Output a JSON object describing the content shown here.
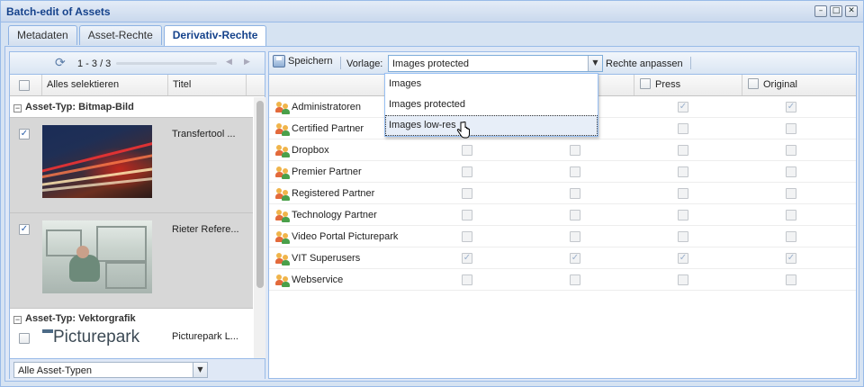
{
  "window": {
    "title": "Batch-edit of Assets",
    "controls": [
      "–",
      "□",
      "✕"
    ]
  },
  "tabs": [
    {
      "label": "Metadaten",
      "active": false
    },
    {
      "label": "Asset-Rechte",
      "active": false
    },
    {
      "label": "Derivativ-Rechte",
      "active": true
    }
  ],
  "left": {
    "pager": "1 - 3 / 3",
    "header": {
      "select_all": "Alles selektieren",
      "title_col": "Titel"
    },
    "groups": [
      {
        "label": "Asset-Typ: Bitmap-Bild"
      },
      {
        "label": "Asset-Typ: Vektorgrafik"
      }
    ],
    "assets": [
      {
        "title": "Transfertool ...",
        "checked": true
      },
      {
        "title": "Rieter Refere...",
        "checked": true
      },
      {
        "title": "Picturepark L...",
        "checked": false,
        "logo_text": "Picturepark"
      }
    ],
    "filter": {
      "value": "Alle Asset-Typen"
    }
  },
  "right": {
    "toolbar": {
      "save_label": "Speichern",
      "vorlage_label": "Vorlage:",
      "vorlage_value": "Images protected",
      "anpassen_label": "Rechte anpassen"
    },
    "columns": [
      "Press",
      "Original"
    ],
    "dropdown_options": [
      "Images",
      "Images protected",
      "Images low-res"
    ],
    "hovered_option": "Images low-res",
    "rows": [
      {
        "name": "Administratoren",
        "c1": false,
        "c2": false,
        "c3": true,
        "c4": true
      },
      {
        "name": "Certified Partner",
        "c1": false,
        "c2": false,
        "c3": false,
        "c4": false
      },
      {
        "name": "Dropbox",
        "c1": false,
        "c2": false,
        "c3": false,
        "c4": false
      },
      {
        "name": "Premier Partner",
        "c1": false,
        "c2": false,
        "c3": false,
        "c4": false
      },
      {
        "name": "Registered Partner",
        "c1": false,
        "c2": false,
        "c3": false,
        "c4": false
      },
      {
        "name": "Technology Partner",
        "c1": false,
        "c2": false,
        "c3": false,
        "c4": false
      },
      {
        "name": "Video Portal Picturepark",
        "c1": false,
        "c2": false,
        "c3": false,
        "c4": false
      },
      {
        "name": "VIT Superusers",
        "c1": true,
        "c2": true,
        "c3": true,
        "c4": true
      },
      {
        "name": "Webservice",
        "c1": false,
        "c2": false,
        "c3": false,
        "c4": false
      }
    ]
  },
  "colors": {
    "accent": "#15428b",
    "border": "#99bbe8",
    "selected_row": "#d7d7d7"
  }
}
